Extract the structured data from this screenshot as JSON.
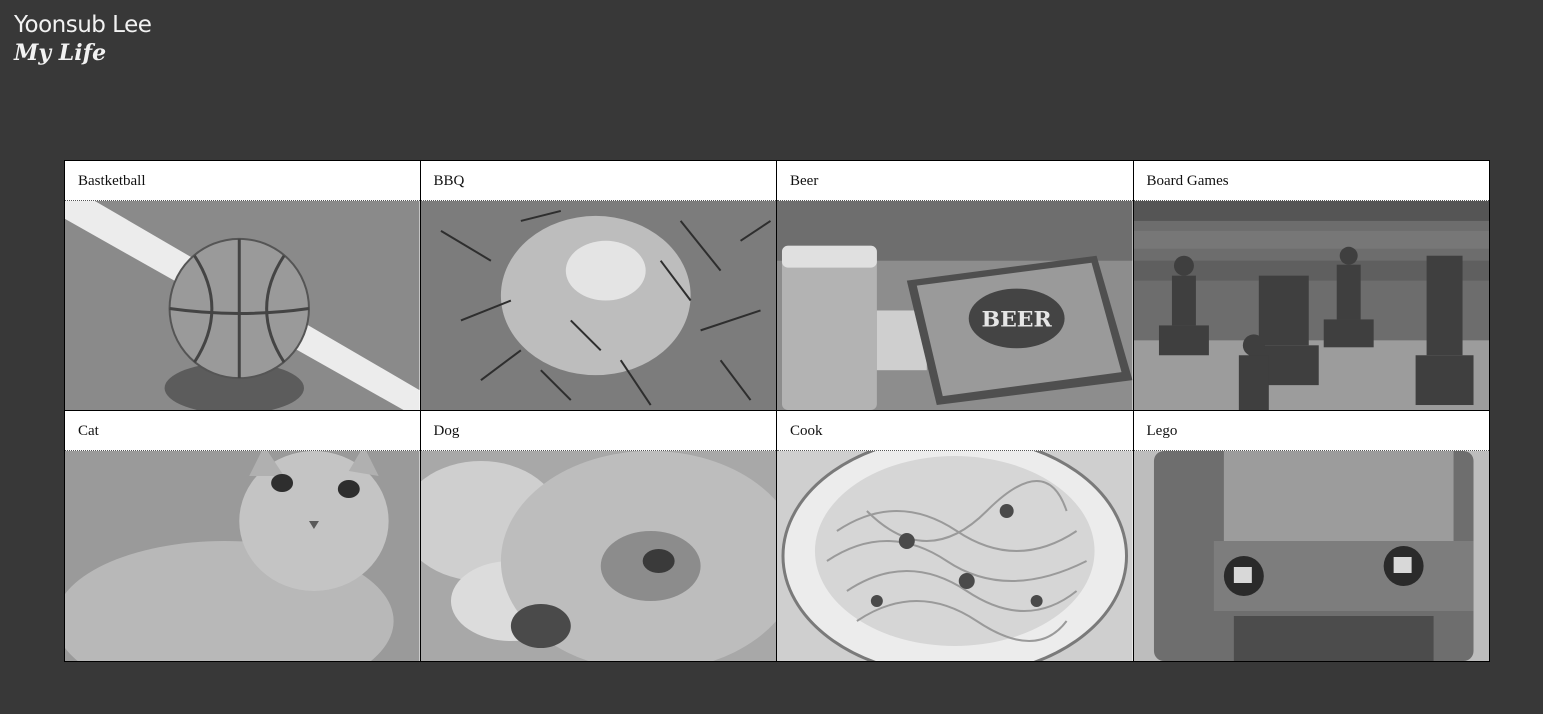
{
  "header": {
    "name": "Yoonsub Lee",
    "subtitle": "My Life"
  },
  "cards": [
    {
      "label": "Bastketball",
      "photo": "basketball-photo"
    },
    {
      "label": "BBQ",
      "photo": "bbq-photo"
    },
    {
      "label": "Beer",
      "photo": "beer-photo"
    },
    {
      "label": "Board Games",
      "photo": "chess-photo"
    },
    {
      "label": "Cat",
      "photo": "cat-photo"
    },
    {
      "label": "Dog",
      "photo": "dog-photo"
    },
    {
      "label": "Cook",
      "photo": "pasta-photo"
    },
    {
      "label": "Lego",
      "photo": "lego-photo"
    }
  ],
  "beer_book_text": "BEER",
  "colors": {
    "page_background": "#383838",
    "header_text": "#f2f2f2",
    "card_border": "#000000",
    "card_label_background": "#ffffff"
  }
}
